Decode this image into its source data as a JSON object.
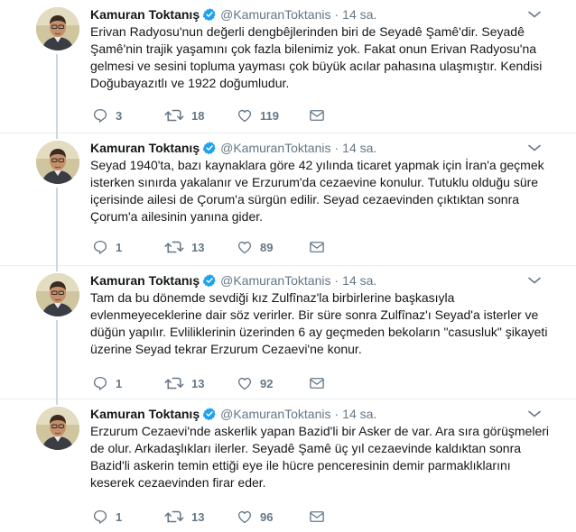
{
  "tweets": [
    {
      "name": "Kamuran Toktanış",
      "handle": "@KamuranToktanis",
      "time": "14 sa.",
      "lines": [
        "Erivan Radyosu'nun değerli dengbêjlerinden biri de Seyadê Şamê'dir. Seyadê",
        "Şamê'nin trajik yaşamını çok fazla bilenimiz yok. Fakat onun Erivan Radyosu'na",
        "gelmesi ve sesini topluma yayması çok büyük acılar pahasına ulaşmıştır. Kendisi",
        "Doğubayazıtlı ve 1922 doğumludur."
      ],
      "replies": "3",
      "retweets": "18",
      "likes": "119"
    },
    {
      "name": "Kamuran Toktanış",
      "handle": "@KamuranToktanis",
      "time": "14 sa.",
      "lines": [
        "Seyad 1940'ta, bazı kaynaklara göre 42 yılında ticaret yapmak için İran'a geçmek",
        "isterken sınırda yakalanır ve Erzurum'da cezaevine konulur. Tutuklu olduğu süre",
        "içerisinde ailesi de Çorum'a sürgün edilir. Seyad cezaevinden çıktıktan sonra",
        "Çorum'a ailesinin yanına gider."
      ],
      "replies": "1",
      "retweets": "13",
      "likes": "89"
    },
    {
      "name": "Kamuran Toktanış",
      "handle": "@KamuranToktanis",
      "time": "14 sa.",
      "lines": [
        "Tam da bu dönemde sevdiği kız Zulfînaz'la birbirlerine başkasıyla",
        "evlenmeyeceklerine dair söz verirler. Bir süre sonra Zulfînaz'ı Seyad'a isterler ve",
        "düğün yapılır. Evliliklerinin üzerinden 6 ay geçmeden bekoların \"casusluk\" şikayeti",
        "üzerine Seyad tekrar Erzurum Cezaevi'ne konur."
      ],
      "replies": "1",
      "retweets": "13",
      "likes": "92"
    },
    {
      "name": "Kamuran Toktanış",
      "handle": "@KamuranToktanis",
      "time": "14 sa.",
      "lines": [
        "Erzurum Cezaevi'nde askerlik yapan Bazid'li bir Asker de var. Ara sıra görüşmeleri",
        "de olur. Arkadaşlıkları ilerler. Seyadê Şamê üç yıl cezaevinde kaldıktan sonra",
        "Bazid'li askerin temin ettiği eye ile hücre penceresinin demir parmaklıklarını",
        "keserek cezaevinden firar eder."
      ],
      "replies": "1",
      "retweets": "13",
      "likes": "96"
    }
  ],
  "colors": {
    "text": "#14171a",
    "muted": "#657786",
    "verified": "#1da1f2",
    "divider": "#e6ecf0",
    "thread_line": "#ccd6dd"
  },
  "icons": {
    "reply": "reply-icon",
    "retweet": "retweet-icon",
    "like": "heart-icon",
    "dm": "mail-icon",
    "verified": "verified-badge-icon",
    "menu": "chevron-down-icon"
  }
}
